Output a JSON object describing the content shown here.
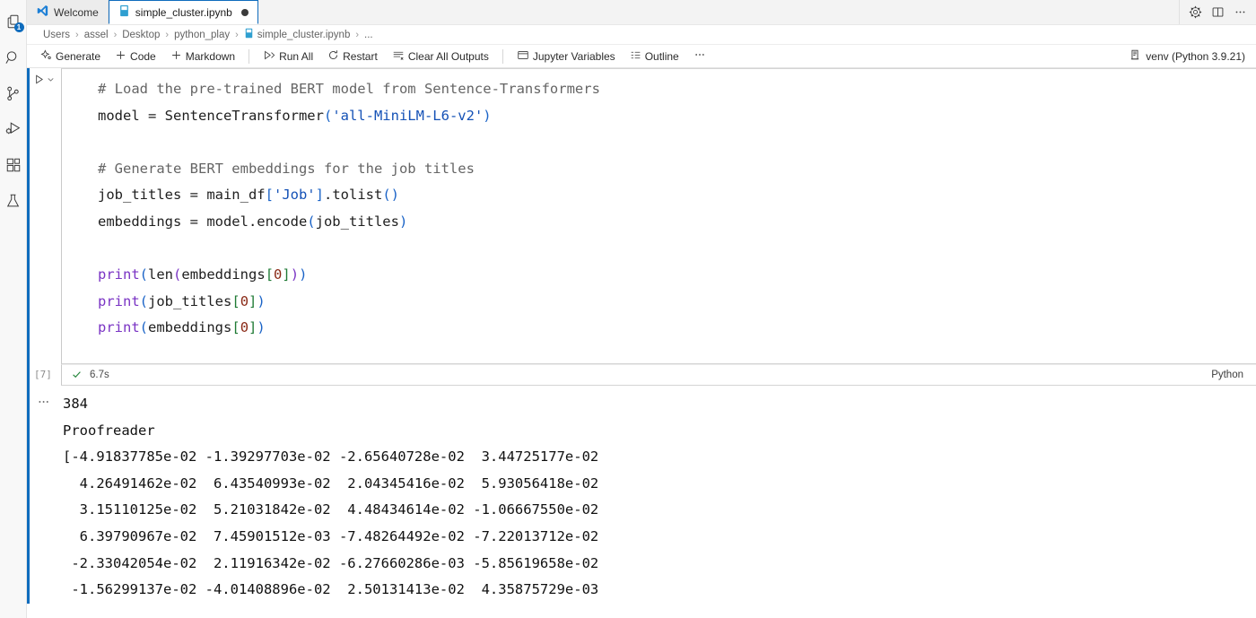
{
  "activitybar": {
    "items": [
      {
        "name": "explorer",
        "icon": "files-icon",
        "badge": "1"
      },
      {
        "name": "search",
        "icon": "search-icon",
        "badge": ""
      },
      {
        "name": "source-control",
        "icon": "source-control-icon",
        "badge": ""
      },
      {
        "name": "run-and-debug",
        "icon": "run-debug-icon",
        "badge": ""
      },
      {
        "name": "extensions",
        "icon": "extensions-icon",
        "badge": ""
      },
      {
        "name": "testing",
        "icon": "beaker-icon",
        "badge": ""
      }
    ]
  },
  "tabs": [
    {
      "label": "Welcome",
      "icon": "vscode-logo-icon",
      "active": false,
      "dirty": false
    },
    {
      "label": "simple_cluster.ipynb",
      "icon": "notebook-icon",
      "active": true,
      "dirty": true
    }
  ],
  "tabbar_actions": [
    {
      "name": "settings-gear",
      "icon": "gear-icon"
    },
    {
      "name": "split-editor",
      "icon": "split-editor-icon"
    },
    {
      "name": "more-actions",
      "icon": "ellipsis-icon"
    }
  ],
  "breadcrumbs": {
    "items": [
      "Users",
      "assel",
      "Desktop",
      "python_play",
      "simple_cluster.ipynb",
      "..."
    ],
    "separator": "›",
    "file_index": 4
  },
  "toolbar": {
    "generate": "Generate",
    "code": "Code",
    "markdown": "Markdown",
    "run_all": "Run All",
    "restart": "Restart",
    "clear_all_outputs": "Clear All Outputs",
    "jupyter_variables": "Jupyter Variables",
    "outline": "Outline",
    "more": "···",
    "kernel": "venv (Python 3.9.21)"
  },
  "cell": {
    "execution_count": "[7]",
    "status_icon": "success-check-icon",
    "duration": "6.7s",
    "language": "Python",
    "code_lines": [
      [
        {
          "t": "# Load the pre-trained BERT model from Sentence-Transformers",
          "c": "cmt"
        }
      ],
      [
        {
          "t": "model = SentenceTransformer",
          "c": "plain"
        },
        {
          "t": "(",
          "c": "br1"
        },
        {
          "t": "'all-MiniLM-L6-v2'",
          "c": "str"
        },
        {
          "t": ")",
          "c": "br1"
        }
      ],
      [
        {
          "t": "",
          "c": "plain"
        }
      ],
      [
        {
          "t": "# Generate BERT embeddings for the job titles",
          "c": "cmt"
        }
      ],
      [
        {
          "t": "job_titles = main_df",
          "c": "plain"
        },
        {
          "t": "[",
          "c": "br1"
        },
        {
          "t": "'Job'",
          "c": "str"
        },
        {
          "t": "]",
          "c": "br1"
        },
        {
          "t": ".tolist",
          "c": "plain"
        },
        {
          "t": "()",
          "c": "br1"
        }
      ],
      [
        {
          "t": "embeddings = model.encode",
          "c": "plain"
        },
        {
          "t": "(",
          "c": "br1"
        },
        {
          "t": "job_titles",
          "c": "plain"
        },
        {
          "t": ")",
          "c": "br1"
        }
      ],
      [
        {
          "t": "",
          "c": "plain"
        }
      ],
      [
        {
          "t": "print",
          "c": "kw"
        },
        {
          "t": "(",
          "c": "br1"
        },
        {
          "t": "len",
          "c": "plain"
        },
        {
          "t": "(",
          "c": "br2"
        },
        {
          "t": "embeddings",
          "c": "plain"
        },
        {
          "t": "[",
          "c": "br3"
        },
        {
          "t": "0",
          "c": "num"
        },
        {
          "t": "]",
          "c": "br3"
        },
        {
          "t": ")",
          "c": "br2"
        },
        {
          "t": ")",
          "c": "br1"
        }
      ],
      [
        {
          "t": "print",
          "c": "kw"
        },
        {
          "t": "(",
          "c": "br1"
        },
        {
          "t": "job_titles",
          "c": "plain"
        },
        {
          "t": "[",
          "c": "br3"
        },
        {
          "t": "0",
          "c": "num"
        },
        {
          "t": "]",
          "c": "br3"
        },
        {
          "t": ")",
          "c": "br1"
        }
      ],
      [
        {
          "t": "print",
          "c": "kw"
        },
        {
          "t": "(",
          "c": "br1"
        },
        {
          "t": "embeddings",
          "c": "plain"
        },
        {
          "t": "[",
          "c": "br3"
        },
        {
          "t": "0",
          "c": "num"
        },
        {
          "t": "]",
          "c": "br3"
        },
        {
          "t": ")",
          "c": "br1"
        }
      ]
    ]
  },
  "output": {
    "more_actions": "···",
    "text": "384\nProofreader\n[-4.91837785e-02 -1.39297703e-02 -2.65640728e-02  3.44725177e-02\n  4.26491462e-02  6.43540993e-02  2.04345416e-02  5.93056418e-02\n  3.15110125e-02  5.21031842e-02  4.48434614e-02 -1.06667550e-02\n  6.39790967e-02  7.45901512e-03 -7.48264492e-02 -7.22013712e-02\n -2.33042054e-02  2.11916342e-02 -6.27660286e-03 -5.85619658e-02\n -1.56299137e-02 -4.01408896e-02  2.50131413e-02  4.35875729e-03"
  },
  "colors": {
    "accent": "#0f6cbd",
    "success": "#24863b",
    "comment": "#656565",
    "keyword": "#7a34c4",
    "string": "#1451b6",
    "number": "#8a2a17"
  }
}
